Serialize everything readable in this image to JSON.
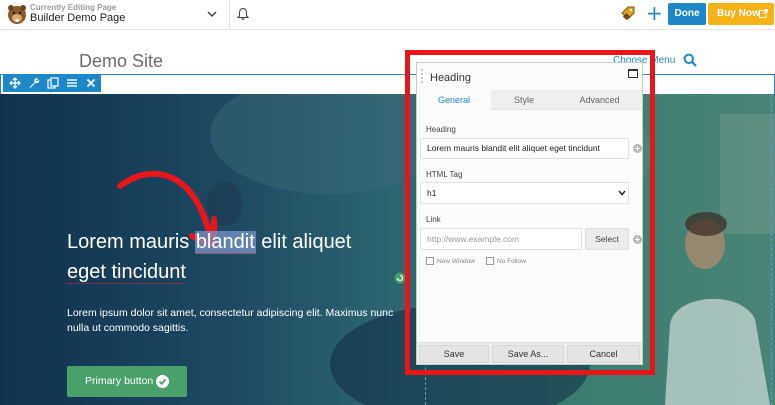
{
  "topbar": {
    "editing_label": "Currently Editing Page",
    "page_title": "Builder Demo Page",
    "done_label": "Done",
    "buy_now_label": "Buy Now"
  },
  "site": {
    "title": "Demo Site",
    "menu_label": "Choose Menu"
  },
  "hero": {
    "heading_pre": "Lorem mauris ",
    "heading_selected": "blandit",
    "heading_post_1": " elit aliquet",
    "heading_line_2": "eget tincidunt",
    "body": "Lorem ipsum dolor sit amet, consectetur adipiscing elit. Maximus nunc nulla ut commodo sagittis.",
    "button_label": "Primary button"
  },
  "panel": {
    "title": "Heading",
    "tabs": [
      {
        "label": "General",
        "active": true
      },
      {
        "label": "Style",
        "active": false
      },
      {
        "label": "Advanced",
        "active": false
      }
    ],
    "heading_field_label": "Heading",
    "heading_value": "Lorem mauris blandit elit aliquet eget tincidunt",
    "html_tag_label": "HTML Tag",
    "html_tag_value": "h1",
    "link_label": "Link",
    "link_placeholder": "http://www.example.com",
    "select_label": "Select",
    "new_window_label": "New Window",
    "no_follow_label": "No Follow",
    "footer": {
      "save": "Save",
      "save_as": "Save As...",
      "cancel": "Cancel"
    }
  },
  "colors": {
    "accent_blue": "#1e88c7",
    "buy_now_yellow": "#f6b317",
    "button_green": "#4aa06a",
    "highlight_red": "#e8161b"
  },
  "icons": {
    "logo": "beaver-logo-icon",
    "dropdown": "chevron-down-icon",
    "notifications": "bell-icon",
    "add": "plus-icon",
    "search": "search-icon",
    "row_tools": [
      "move-icon",
      "wrench-icon",
      "duplicate-icon",
      "menu-icon",
      "close-icon"
    ],
    "annotation": "red-arrow"
  }
}
